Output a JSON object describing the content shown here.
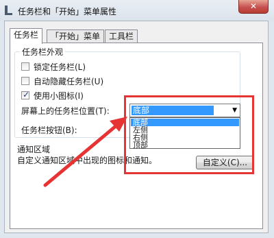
{
  "window": {
    "title": "任务栏和「开始」菜单属性",
    "close_label": "✕",
    "title_icon": "taskbar-properties-icon"
  },
  "tabs": [
    {
      "label": "任务栏"
    },
    {
      "label": "「开始」菜单"
    },
    {
      "label": "工具栏"
    }
  ],
  "appearance": {
    "title": "任务栏外观",
    "lock": {
      "label": "锁定任务栏(L)",
      "checked": false
    },
    "autohide": {
      "label": "自动隐藏任务栏(U)",
      "checked": false
    },
    "small_icons": {
      "label": "使用小图标(I)",
      "checked": true,
      "mark": "✓"
    },
    "position_label": "屏幕上的任务栏位置(T):",
    "buttons_label": "任务栏按钮(B):"
  },
  "position_dropdown": {
    "value": "底部",
    "arrow": "▼",
    "options": [
      "底部",
      "左侧",
      "右侧",
      "顶部"
    ],
    "selected_index": 0
  },
  "notify": {
    "title": "通知区域",
    "text": "自定义通知区域中出现的图标和通知。",
    "button": "自定义(C)..."
  },
  "annotation": {
    "highlight_color": "#e63434",
    "arrow_color": "#e63434"
  }
}
